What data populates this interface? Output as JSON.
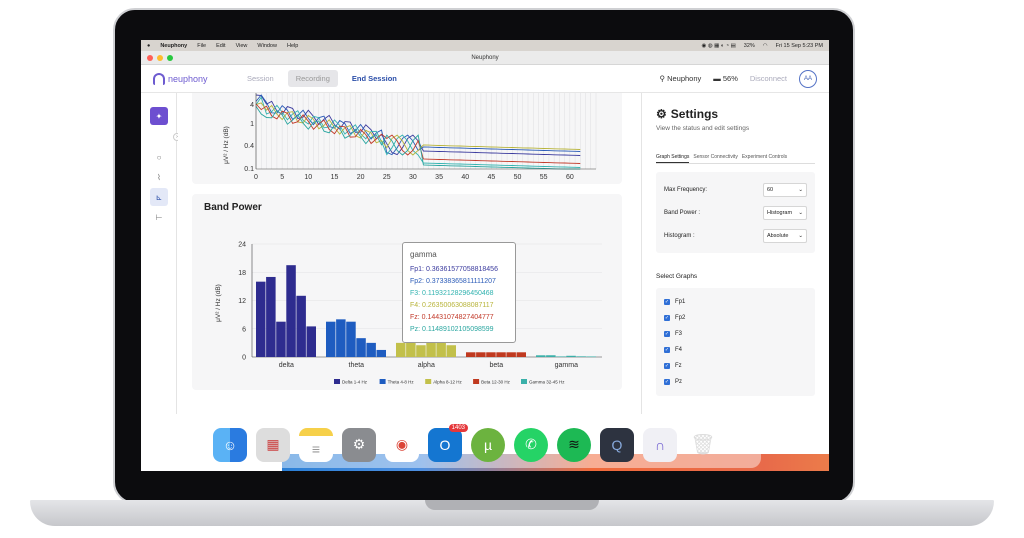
{
  "menubar": {
    "app": "Neuphony",
    "items": [
      "File",
      "Edit",
      "View",
      "Window",
      "Help"
    ],
    "battery": "32%",
    "datetime": "Fri 15 Sep  5:23 PM"
  },
  "window": {
    "title": "Neuphony"
  },
  "appbar": {
    "logo": "neuphony",
    "nav": {
      "session": "Session",
      "recording": "Recording",
      "end_session": "End Session"
    },
    "device": "Neuphony",
    "battery": "56%",
    "disconnect": "Disconnect",
    "avatar": "AA"
  },
  "spectrum": {
    "ylabel": "μV² / Hz (dB)",
    "yticks": [
      "4",
      "1",
      "0.4",
      "0.1"
    ],
    "xticks": [
      "0",
      "5",
      "10",
      "15",
      "20",
      "25",
      "30",
      "35",
      "40",
      "45",
      "50",
      "55",
      "60"
    ]
  },
  "band_power": {
    "title": "Band Power",
    "ylabel": "μV² / Hz (dB)",
    "yticks": [
      "24",
      "18",
      "12",
      "6",
      "0"
    ],
    "categories": [
      "delta",
      "theta",
      "alpha",
      "beta",
      "gamma"
    ],
    "legend": [
      "Delta 1-4 Hz",
      "Theta 4-8 Hz",
      "Alpha 8-12 Hz",
      "Beta 12-30 Hz",
      "Gamma 32-45 Hz"
    ],
    "tooltip": {
      "title": "gamma",
      "lines": [
        {
          "text": "Fp1: 0.36361577058818456",
          "color": "#3b3b9e"
        },
        {
          "text": "Fp2: 0.37338365811111207",
          "color": "#2c5cb8"
        },
        {
          "text": "F3: 0.11932128296450468",
          "color": "#32b3b0"
        },
        {
          "text": "F4: 0.26350063088087117",
          "color": "#b8b43a"
        },
        {
          "text": "Fz: 0.14431074827404777",
          "color": "#c23a2a"
        },
        {
          "text": "Pz: 0.11489102105098599",
          "color": "#2aa6a0"
        }
      ]
    }
  },
  "chart_data": {
    "type": "bar",
    "categories": [
      "delta",
      "theta",
      "alpha",
      "beta",
      "gamma"
    ],
    "series": [
      {
        "name": "Delta 1-4 Hz",
        "values": [
          16,
          17,
          7.5,
          19.5,
          13,
          6.5
        ]
      },
      {
        "name": "Theta 4-8 Hz",
        "values": [
          7.5,
          8,
          7.5,
          4,
          3,
          1.5
        ]
      },
      {
        "name": "Alpha 8-12 Hz",
        "values": [
          3,
          3,
          2.5,
          3,
          3,
          2.5
        ]
      },
      {
        "name": "Beta 12-30 Hz",
        "values": [
          1,
          1,
          1,
          1,
          1,
          1
        ]
      },
      {
        "name": "Gamma 32-45 Hz",
        "values": [
          0.36,
          0.37,
          0.12,
          0.26,
          0.14,
          0.11
        ]
      }
    ],
    "colors": [
      "#2e2c8f",
      "#1e5cc0",
      "#c2c04a",
      "#c0391f",
      "#3ab0a9"
    ],
    "ylabel": "μV² / Hz (dB)",
    "ylim": [
      0,
      24
    ]
  },
  "settings": {
    "title": "Settings",
    "subtitle": "View the status and edit settings",
    "tabs": [
      "Graph Settings",
      "Sensor Connectivity",
      "Experiment Controls"
    ],
    "fields": [
      {
        "label": "Max Frequency:",
        "value": "60"
      },
      {
        "label": "Band Power :",
        "value": "Histogram"
      },
      {
        "label": "Histogram :",
        "value": "Absolute"
      }
    ],
    "select_graphs_title": "Select Graphs",
    "graphs": [
      "Fp1",
      "Fp2",
      "F3",
      "F4",
      "Fz",
      "Pz"
    ]
  },
  "dock": {
    "badge": "1403",
    "apps": [
      "finder-icon",
      "launchpad-icon",
      "notes-icon",
      "settings-icon",
      "chrome-icon",
      "outlook-icon",
      "utorrent-icon",
      "whatsapp-icon",
      "spotify-icon",
      "quicktime-icon",
      "neuphony-icon",
      "trash-icon"
    ]
  }
}
